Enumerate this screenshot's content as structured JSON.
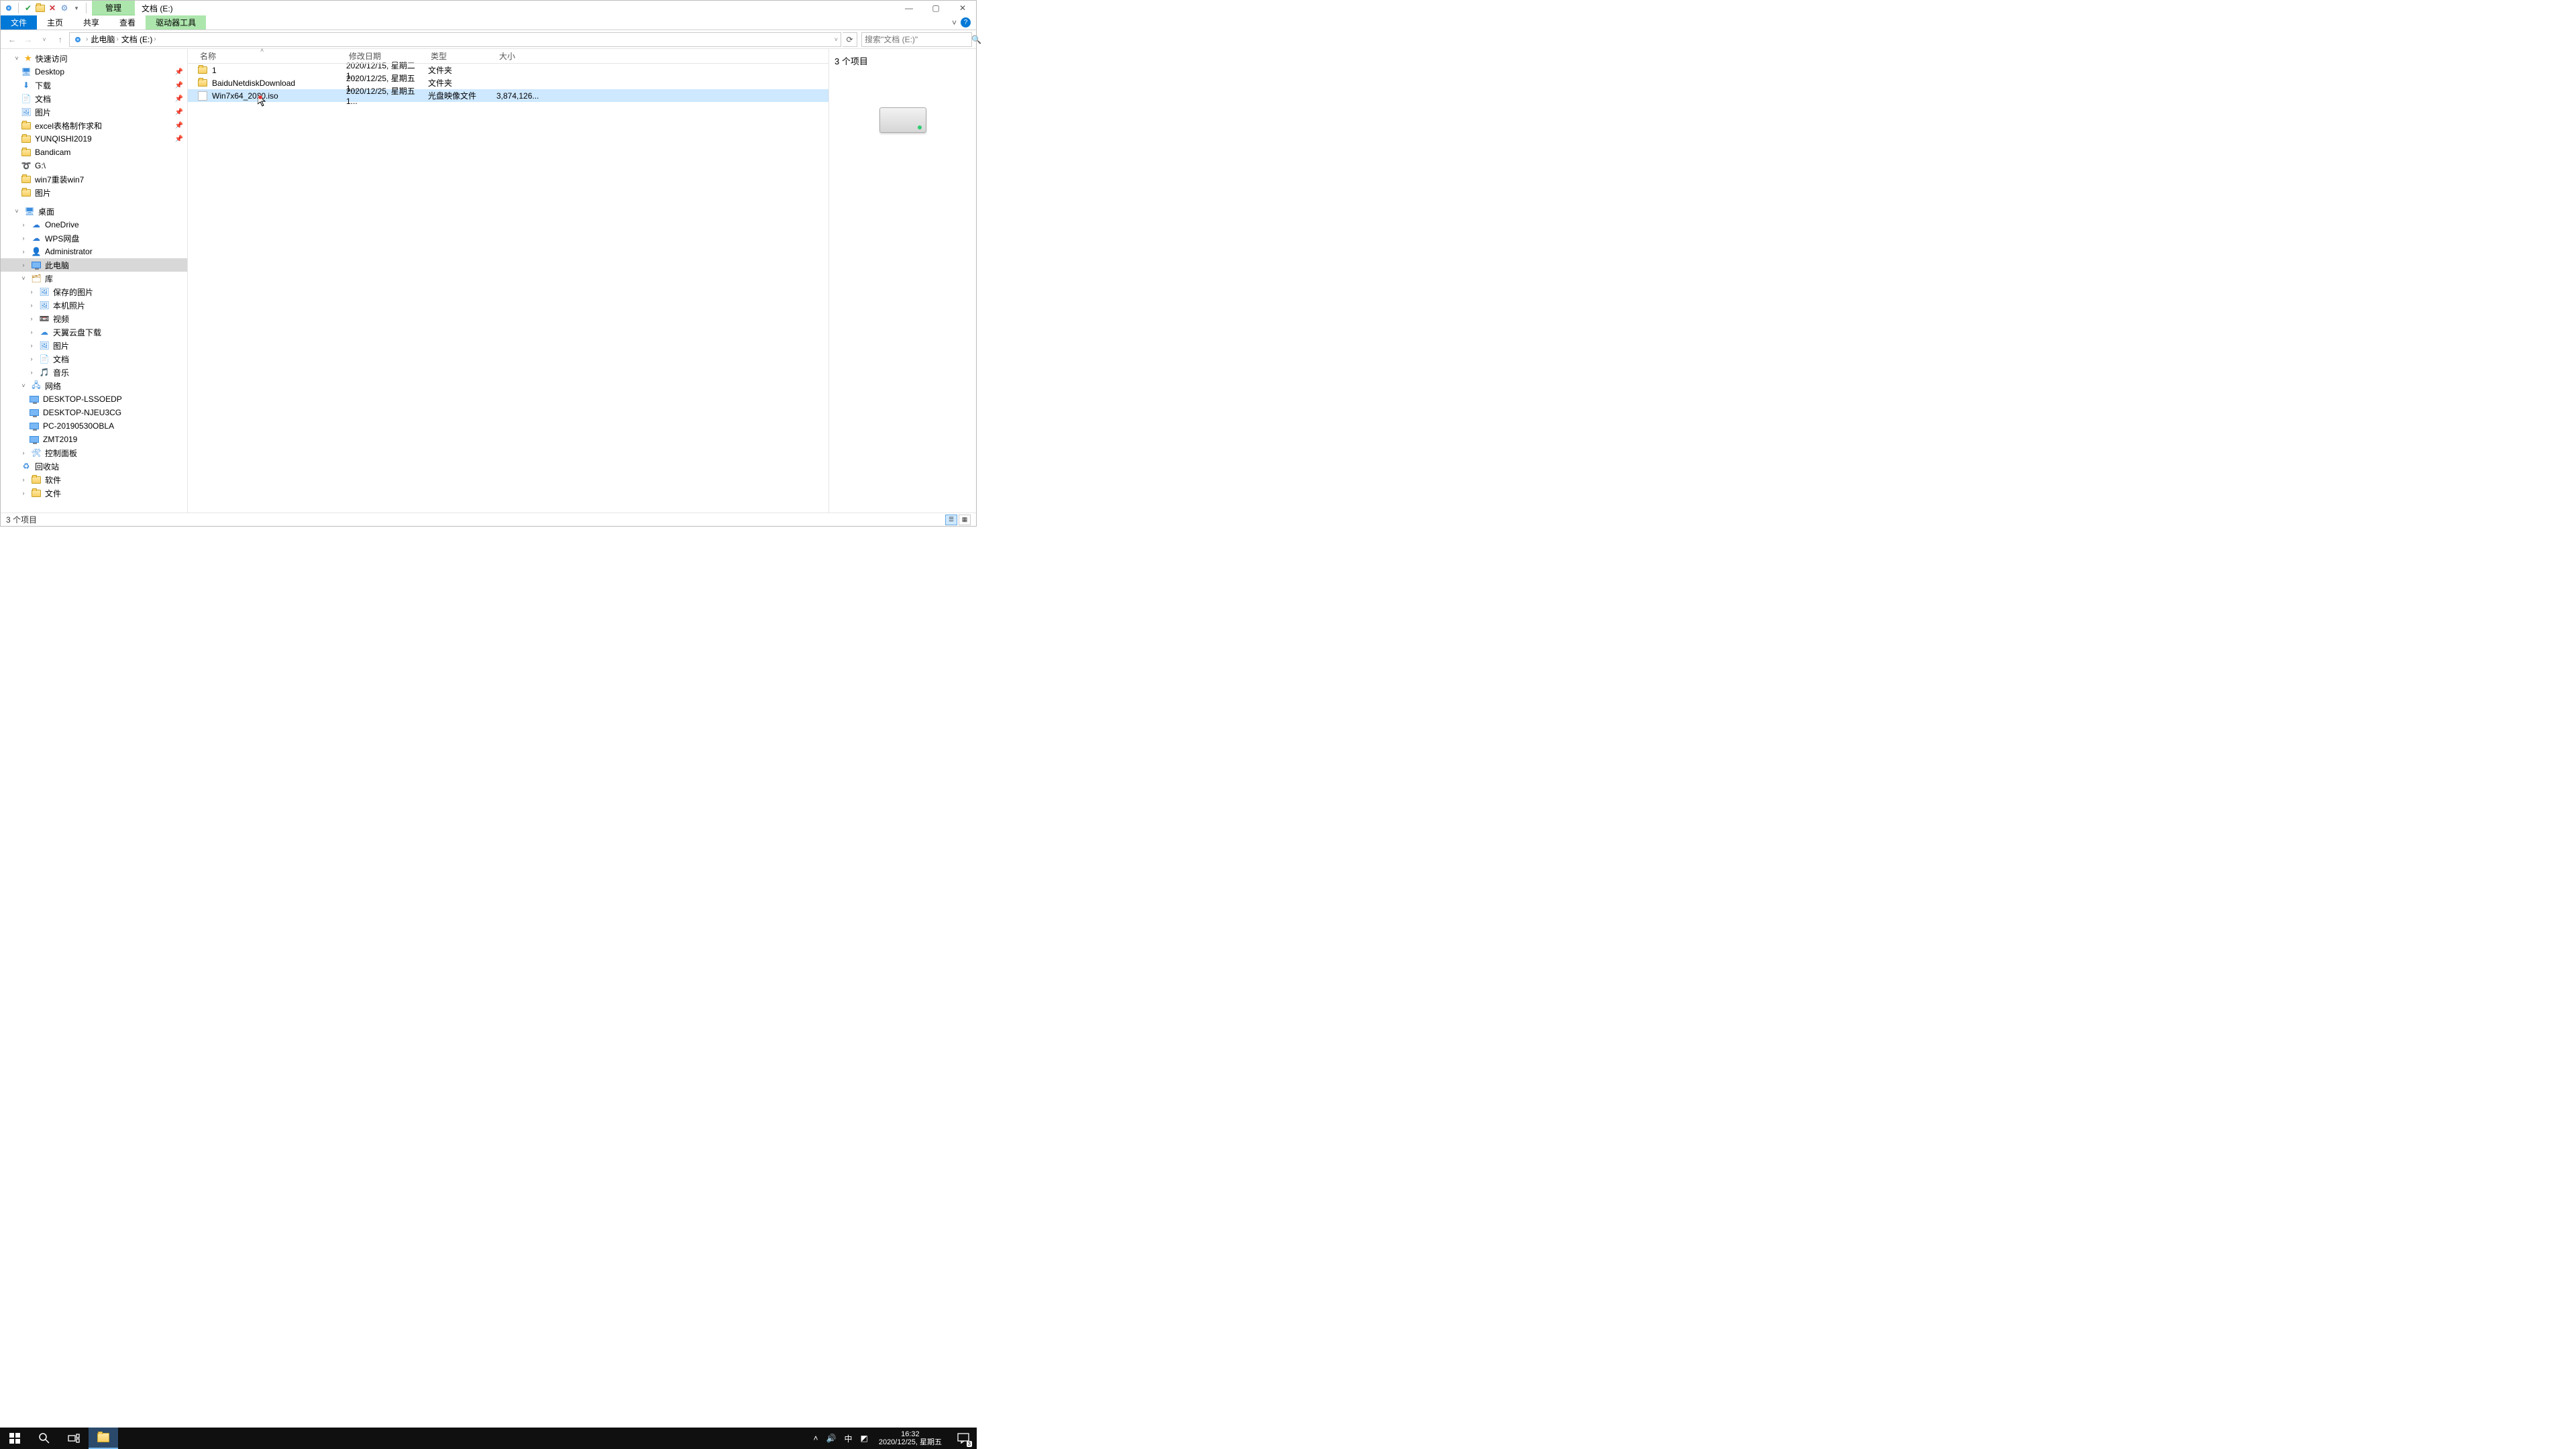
{
  "title_context": "管理",
  "title_path": "文档 (E:)",
  "ribbon": {
    "file": "文件",
    "home": "主页",
    "share": "共享",
    "view": "查看",
    "context": "驱动器工具"
  },
  "breadcrumb": [
    "此电脑",
    "文档 (E:)"
  ],
  "search_placeholder": "搜索\"文档 (E:)\"",
  "columns": {
    "name": "名称",
    "date": "修改日期",
    "type": "类型",
    "size": "大小"
  },
  "rows": [
    {
      "icon": "folder",
      "name": "1",
      "date": "2020/12/15, 星期二 1...",
      "type": "文件夹",
      "size": "",
      "sel": false
    },
    {
      "icon": "folder",
      "name": "BaiduNetdiskDownload",
      "date": "2020/12/25, 星期五 1...",
      "type": "文件夹",
      "size": "",
      "sel": false
    },
    {
      "icon": "iso",
      "name": "Win7x64_2020.iso",
      "date": "2020/12/25, 星期五 1...",
      "type": "光盘映像文件",
      "size": "3,874,126...",
      "sel": true
    }
  ],
  "tree": {
    "quick": "快速访问",
    "quick_items": [
      "Desktop",
      "下载",
      "文档",
      "图片",
      "excel表格制作求和",
      "YUNQISHI2019",
      "Bandicam",
      "G:\\",
      "win7重装win7",
      "图片"
    ],
    "desktop": "桌面",
    "desk_items": [
      "OneDrive",
      "WPS网盘",
      "Administrator",
      "此电脑",
      "库"
    ],
    "lib_items": [
      "保存的图片",
      "本机照片",
      "视频",
      "天翼云盘下载",
      "图片",
      "文档",
      "音乐"
    ],
    "network": "网络",
    "net_items": [
      "DESKTOP-LSSOEDP",
      "DESKTOP-NJEU3CG",
      "PC-20190530OBLA",
      "ZMT2019"
    ],
    "panel": "控制面板",
    "recycle": "回收站",
    "soft": "软件",
    "docs": "文件"
  },
  "preview_count": "3 个项目",
  "status": "3 个项目",
  "tray": {
    "ime": "中",
    "time": "16:32",
    "date": "2020/12/25, 星期五",
    "notif": "3"
  }
}
